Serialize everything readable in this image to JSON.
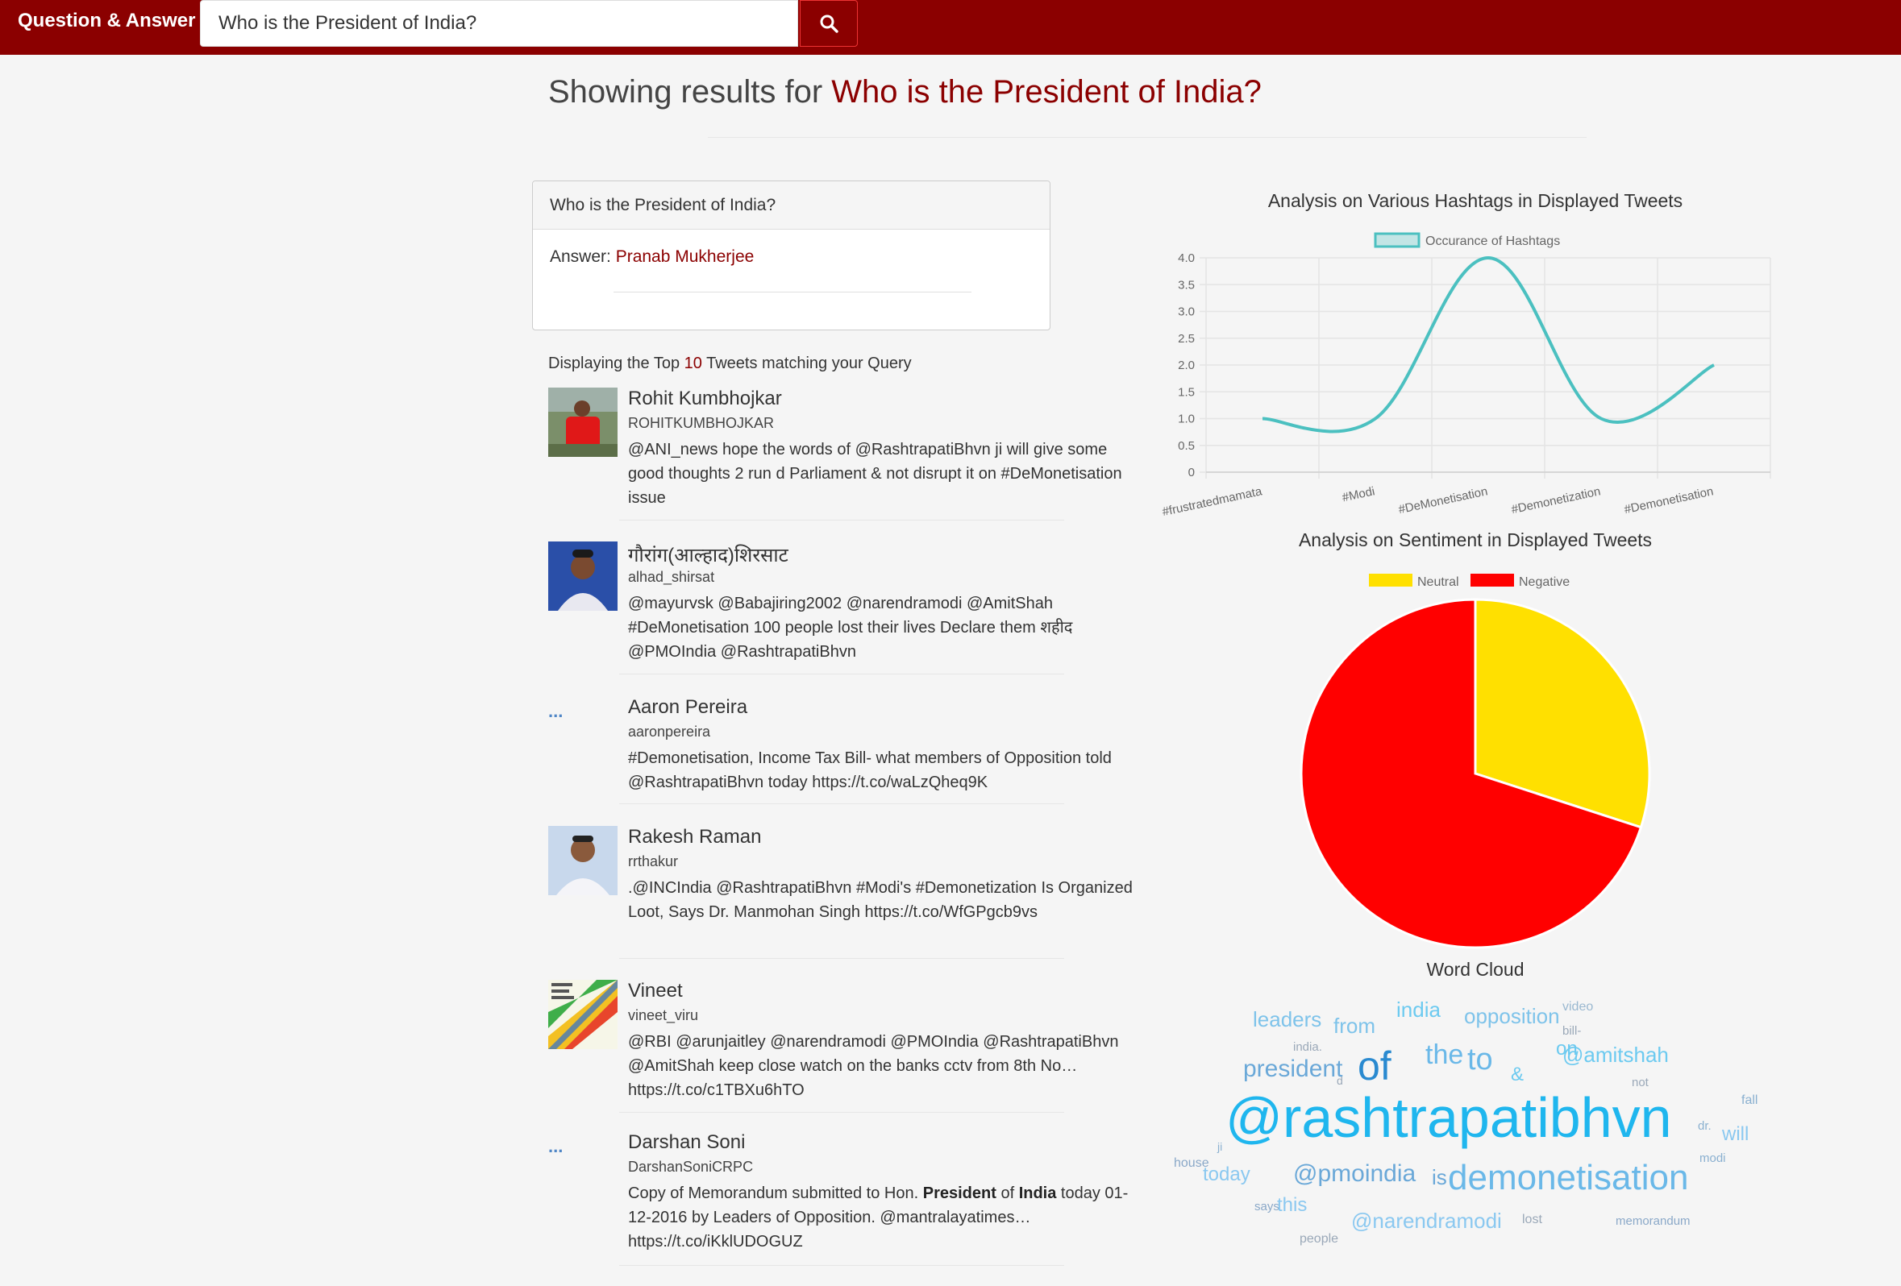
{
  "app": {
    "title": "Question & Answer"
  },
  "search": {
    "value": "Who is the President of India?",
    "icon": "search-icon"
  },
  "heading": {
    "prefix": "Showing results for",
    "query": "Who is the President of India?"
  },
  "answer_card": {
    "question": "Who is the President of India?",
    "answer_label": "Answer:",
    "answer_value": "Pranab Mukherjee"
  },
  "tweets_caption": {
    "prefix": "Displaying the Top",
    "count": "10",
    "suffix": "Tweets matching your Query"
  },
  "tweets": [
    {
      "name": "Rohit Kumbhojkar",
      "handle": "ROHITKUMBHOJKAR",
      "avatar": "photo",
      "text": "@ANI_news hope the words of @RashtrapatiBhvn ji will give some good thoughts 2 run d Parliament & not disrupt it on #DeMonetisation issue"
    },
    {
      "name": "गौरांग(आल्हाद)शिरसाट",
      "handle": "alhad_shirsat",
      "avatar": "photo",
      "text": "@mayurvsk @Babajiring2002 @narendramodi @AmitShah #DeMonetisation 100 people lost their lives Declare them शहीद @PMOIndia @RashtrapatiBhvn"
    },
    {
      "name": "Aaron Pereira",
      "handle": "aaronpereira",
      "avatar": "...",
      "text": "#Demonetisation, Income Tax Bill- what members of Opposition told @RashtrapatiBhvn today https://t.co/waLzQheq9K"
    },
    {
      "name": "Rakesh Raman",
      "handle": "rrthakur",
      "avatar": "photo",
      "text": ".@INCIndia @RashtrapatiBhvn #Modi's #Demonetization Is Organized Loot, Says Dr. Manmohan Singh https://t.co/WfGPgcb9vs"
    },
    {
      "name": "Vineet",
      "handle": "vineet_viru",
      "avatar": "poster",
      "text": "@RBI @arunjaitley @narendramodi @PMOIndia @RashtrapatiBhvn @AmitShah keep close watch on the banks cctv from 8th No… https://t.co/c1TBXu6hTO"
    },
    {
      "name": "Darshan Soni",
      "handle": "DarshanSoniCRPC",
      "avatar": "...",
      "text_parts": [
        "Copy of Memorandum submitted to Hon. ",
        "President",
        " of ",
        "India",
        " today 01-12-2016 by Leaders of Opposition. @mantralayatimes… https://t.co/iKklUDOGUZ"
      ]
    }
  ],
  "chart_data": [
    {
      "type": "line",
      "title": "Analysis on Various Hashtags in Displayed Tweets",
      "series": [
        {
          "name": "Occurance of Hashtags",
          "values": [
            1,
            1,
            4,
            1,
            2
          ],
          "color": "#4bc0c0"
        }
      ],
      "categories": [
        "#frustratedmamata",
        "#Modi",
        "#DeMonetisation",
        "#Demonetization",
        "#Demonetisation"
      ],
      "ylim": [
        0,
        4
      ],
      "yticks": [
        "0",
        "0.5",
        "1.0",
        "1.5",
        "2.0",
        "2.5",
        "3.0",
        "3.5",
        "4.0"
      ],
      "grid": true,
      "legend": "top"
    },
    {
      "type": "pie",
      "title": "Analysis on Sentiment in Displayed Tweets",
      "categories": [
        "Neutral",
        "Negative"
      ],
      "values": [
        3,
        7
      ],
      "colors": [
        "#ffe000",
        "#ff0000"
      ],
      "legend": "top"
    }
  ],
  "word_cloud": {
    "title": "Word Cloud",
    "words": [
      {
        "text": "leaders",
        "color": "#7ec3ea"
      },
      {
        "text": "from",
        "color": "#7ec3ea"
      },
      {
        "text": "india",
        "color": "#6ccaf0"
      },
      {
        "text": "opposition",
        "color": "#7ec3ea"
      },
      {
        "text": "video",
        "color": "#9ab8d0"
      },
      {
        "text": "bill-",
        "color": "#9aa8b8"
      },
      {
        "text": "india.",
        "color": "#9aa8b8"
      },
      {
        "text": "president",
        "color": "#6aa8d8"
      },
      {
        "text": "d",
        "color": "#9aa8b8"
      },
      {
        "text": "of",
        "color": "#2a8ad0"
      },
      {
        "text": "the",
        "color": "#6ab8e8"
      },
      {
        "text": "to",
        "color": "#6ab8e8"
      },
      {
        "text": "on",
        "color": "#6ccaf0"
      },
      {
        "text": "&",
        "color": "#6ccaf0"
      },
      {
        "text": "@amitshah",
        "color": "#6ccaf0"
      },
      {
        "text": "not",
        "color": "#9aa8b8"
      },
      {
        "text": "fall",
        "color": "#8ab0d0"
      },
      {
        "text": "@rashtrapatibhvn",
        "color": "#1fb6ee"
      },
      {
        "text": "dr.",
        "color": "#8ab0d0"
      },
      {
        "text": "will",
        "color": "#8ac8f0"
      },
      {
        "text": "ji",
        "color": "#8ab0d0"
      },
      {
        "text": "house",
        "color": "#8aa8c8"
      },
      {
        "text": "today",
        "color": "#8ac8f0"
      },
      {
        "text": "@pmoindia",
        "color": "#6aa8d8"
      },
      {
        "text": "is",
        "color": "#6aa8d8"
      },
      {
        "text": "demonetisation",
        "color": "#6ab8e8"
      },
      {
        "text": "modi",
        "color": "#8ab0d0"
      },
      {
        "text": "says",
        "color": "#8aa8c8"
      },
      {
        "text": "this",
        "color": "#8ac8f0"
      },
      {
        "text": "@narendramodi",
        "color": "#8ac8f0"
      },
      {
        "text": "lost",
        "color": "#9aa8b8"
      },
      {
        "text": "memorandum",
        "color": "#8aa8c8"
      },
      {
        "text": "people",
        "color": "#9aa8b8"
      }
    ]
  }
}
